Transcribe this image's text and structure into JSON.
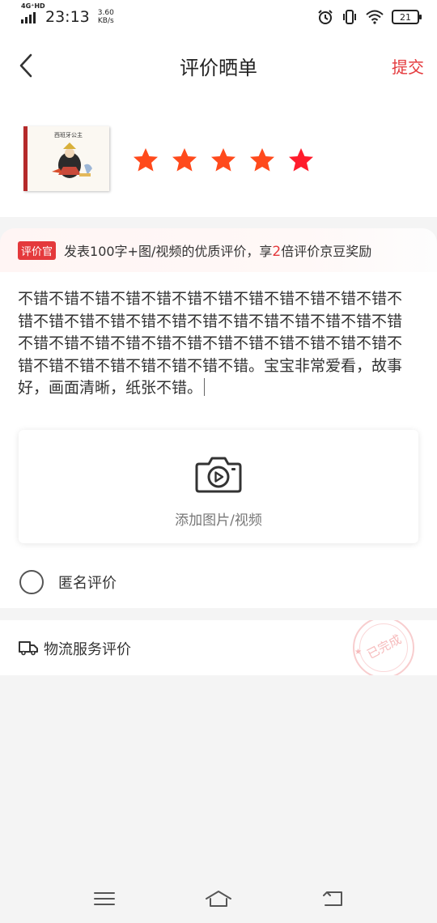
{
  "status_bar": {
    "network": "4G⁺HD",
    "time": "23:13",
    "speed_value": "3.60",
    "speed_unit": "KB/s",
    "battery": "21",
    "icons": [
      "alarm-icon",
      "vibrate-icon",
      "wifi-icon",
      "battery-icon"
    ]
  },
  "header": {
    "title": "评价晒单",
    "submit_label": "提交",
    "back_icon": "back-arrow-icon"
  },
  "product": {
    "book_title": "西班牙公主",
    "rating": 5,
    "rating_max": 5
  },
  "banner": {
    "badge": "评价官",
    "text_before": "发表100字+图/视频的优质评价，享",
    "highlight": "2",
    "text_after": "倍评价京豆奖励"
  },
  "review": {
    "text": "不错不错不错不错不错不错不错不错不错不错不错不错不错不错不错不错不错不错不错不错不错不错不错不错不错不错不错不错不错不错不错不错不错不错不错不错不错不错不错不错不错不错不错不错不错。宝宝非常爱看，故事好，画面清晰，纸张不错。"
  },
  "upload": {
    "label": "添加图片/视频",
    "icon": "camera-video-icon"
  },
  "anonymous": {
    "label": "匿名评价",
    "checked": false
  },
  "logistics": {
    "label": "物流服务评价",
    "stamp": "已完成"
  },
  "colors": {
    "accent": "#e4393c",
    "star": "#ff4a1c"
  }
}
